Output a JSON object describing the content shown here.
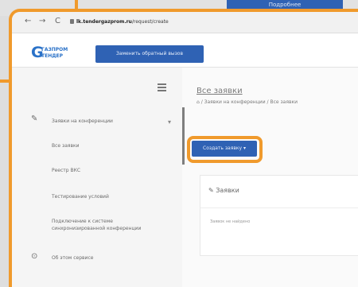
{
  "top_button": {
    "label": "Подробнее"
  },
  "browser": {
    "back": "←",
    "forward": "→",
    "reload": "C",
    "url_host": "lk.tendergazprom.ru",
    "url_rest": "/request/create"
  },
  "header": {
    "logo_line1": "ГАЗПРОМ",
    "logo_line2": "ТЕНДЕР",
    "change_button": "Заменить обратный вызов"
  },
  "sidebar": {
    "section": "Заявки на конференции",
    "items": [
      "Все заявки",
      "Реестр ВКС",
      "Тестирование условий",
      "Подключение к системе",
      "синхронизированной конференции"
    ],
    "bottom": "Об этом сервисе"
  },
  "main": {
    "title": "Все заявки",
    "breadcrumb_1": "Заявки на конференции",
    "breadcrumb_2": "Все заявки",
    "create_button": "Создать заявку",
    "panel_title": "Заявки",
    "panel_empty": "Заявок не найдено"
  },
  "colors": {
    "accent": "#2f62b4",
    "callout": "#f09a2c"
  }
}
